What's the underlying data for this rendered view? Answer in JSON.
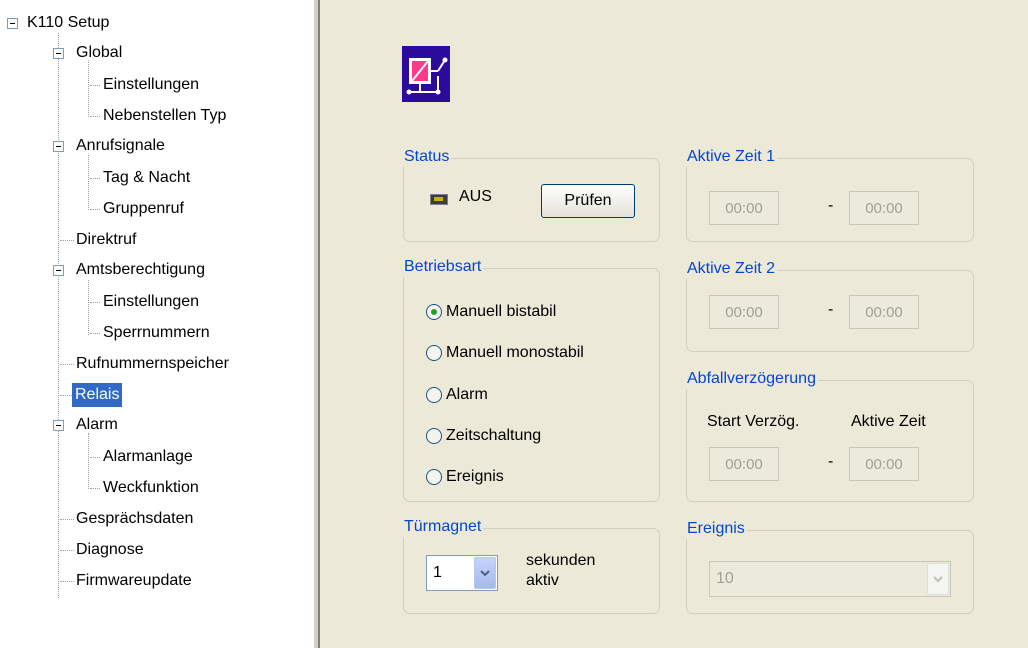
{
  "tree": {
    "root": "K110 Setup",
    "global": "Global",
    "global_einstellungen": "Einstellungen",
    "global_nebenstellen": "Nebenstellen Typ",
    "anrufsignale": "Anrufsignale",
    "tag_nacht": "Tag & Nacht",
    "gruppenruf": "Gruppenruf",
    "direktruf": "Direktruf",
    "amtsberechtigung": "Amtsberechtigung",
    "amts_einstellungen": "Einstellungen",
    "sperrnummern": "Sperrnummern",
    "rufnummernspeicher": "Rufnummernspeicher",
    "relais": "Relais",
    "alarm": "Alarm",
    "alarmanlage": "Alarmanlage",
    "weckfunktion": "Weckfunktion",
    "gespraechsdaten": "Gesprächsdaten",
    "diagnose": "Diagnose",
    "firmwareupdate": "Firmwareupdate",
    "selected": "Relais"
  },
  "status": {
    "title": "Status",
    "value": "AUS",
    "button": "Prüfen"
  },
  "aktive_zeit_1": {
    "title": "Aktive Zeit 1",
    "from": "00:00",
    "sep": "-",
    "to": "00:00"
  },
  "aktive_zeit_2": {
    "title": "Aktive Zeit 2",
    "from": "00:00",
    "sep": "-",
    "to": "00:00"
  },
  "betriebsart": {
    "title": "Betriebsart",
    "options": [
      "Manuell bistabil",
      "Manuell monostabil",
      "Alarm",
      "Zeitschaltung",
      "Ereignis"
    ],
    "selected": "Manuell bistabil"
  },
  "abfall": {
    "title": "Abfallverzögerung",
    "col1": "Start Verzög.",
    "col2": "Aktive Zeit",
    "from": "00:00",
    "sep": "-",
    "to": "00:00"
  },
  "tuermagnet": {
    "title": "Türmagnet",
    "value": "1",
    "suffix_line1": "sekunden",
    "suffix_line2": "aktiv"
  },
  "ereignis": {
    "title": "Ereignis",
    "value": "10"
  },
  "colors": {
    "selection": "#316ac5",
    "group_title": "#0046d5",
    "panel_bg": "#ece9d8"
  }
}
